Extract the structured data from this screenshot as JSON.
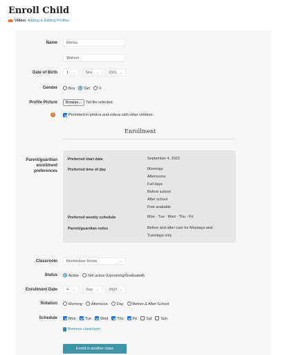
{
  "page": {
    "title": "Enroll Child",
    "video_label": "Video:",
    "video_link": "Adding & Editing Profiles"
  },
  "form": {
    "name_label": "Name",
    "first_name": "Emma",
    "last_name": "Watson",
    "dob_label": "Date of Birth",
    "dob_day": "1",
    "dob_month": "Nov",
    "dob_year": "2021",
    "gender_label": "Gender",
    "gender_options": [
      "Boy",
      "Girl",
      "X"
    ],
    "gender_selected": "Girl",
    "picture_label": "Profile Picture",
    "browse_label": "Browse...",
    "no_file": "No file selected.",
    "photo_permission": "Permitted in photos and videos with other children"
  },
  "enrollment": {
    "section_title": "Enrollment",
    "prefs_label_1": "Parent/guardian",
    "prefs_label_2": "enrollment",
    "prefs_label_3": "preferences",
    "start_date_label": "Preferred start date",
    "start_date_value": "September 4, 2023",
    "time_label": "Preferred time of day",
    "times": [
      "Mornings",
      "Afternoons",
      "Full days",
      "Before school",
      "After school",
      "First available"
    ],
    "weekly_label": "Preferred weekly schedule",
    "weekly_value": "Mon · Tue · Wed · Thu · Fri",
    "notes_label": "Parent/guardian notes",
    "notes_line_1": "Before and after care for Mondays and",
    "notes_line_2": "Tuesdays only",
    "classroom_label": "Classroom",
    "classroom_value": "Bumblebee Room",
    "status_label": "Status",
    "status_active": "Active",
    "status_inactive": "Not active (Upcoming/Graduated)",
    "enroll_date_label": "Enrollment Date",
    "enroll_day": "4",
    "enroll_month": "Sep",
    "enroll_year": "2023",
    "rotation_label": "Rotation",
    "rotation_options": [
      "Morning",
      "Afternoon",
      "Day",
      "Before & After School"
    ],
    "schedule_label": "Schedule",
    "schedule_days": [
      {
        "label": "Mon",
        "checked": true
      },
      {
        "label": "Tue",
        "checked": true
      },
      {
        "label": "Wed",
        "checked": true
      },
      {
        "label": "Thu",
        "checked": true
      },
      {
        "label": "Fri",
        "checked": true
      },
      {
        "label": "Sat",
        "checked": false
      },
      {
        "label": "Sun",
        "checked": false
      }
    ],
    "remove_classroom": "Remove classroom",
    "enroll_another": "Enroll in another class"
  },
  "colors": {
    "accent": "#2a8aa8",
    "orange": "#e8742b",
    "check_blue": "#1a73e8",
    "button": "#3f95a8"
  }
}
